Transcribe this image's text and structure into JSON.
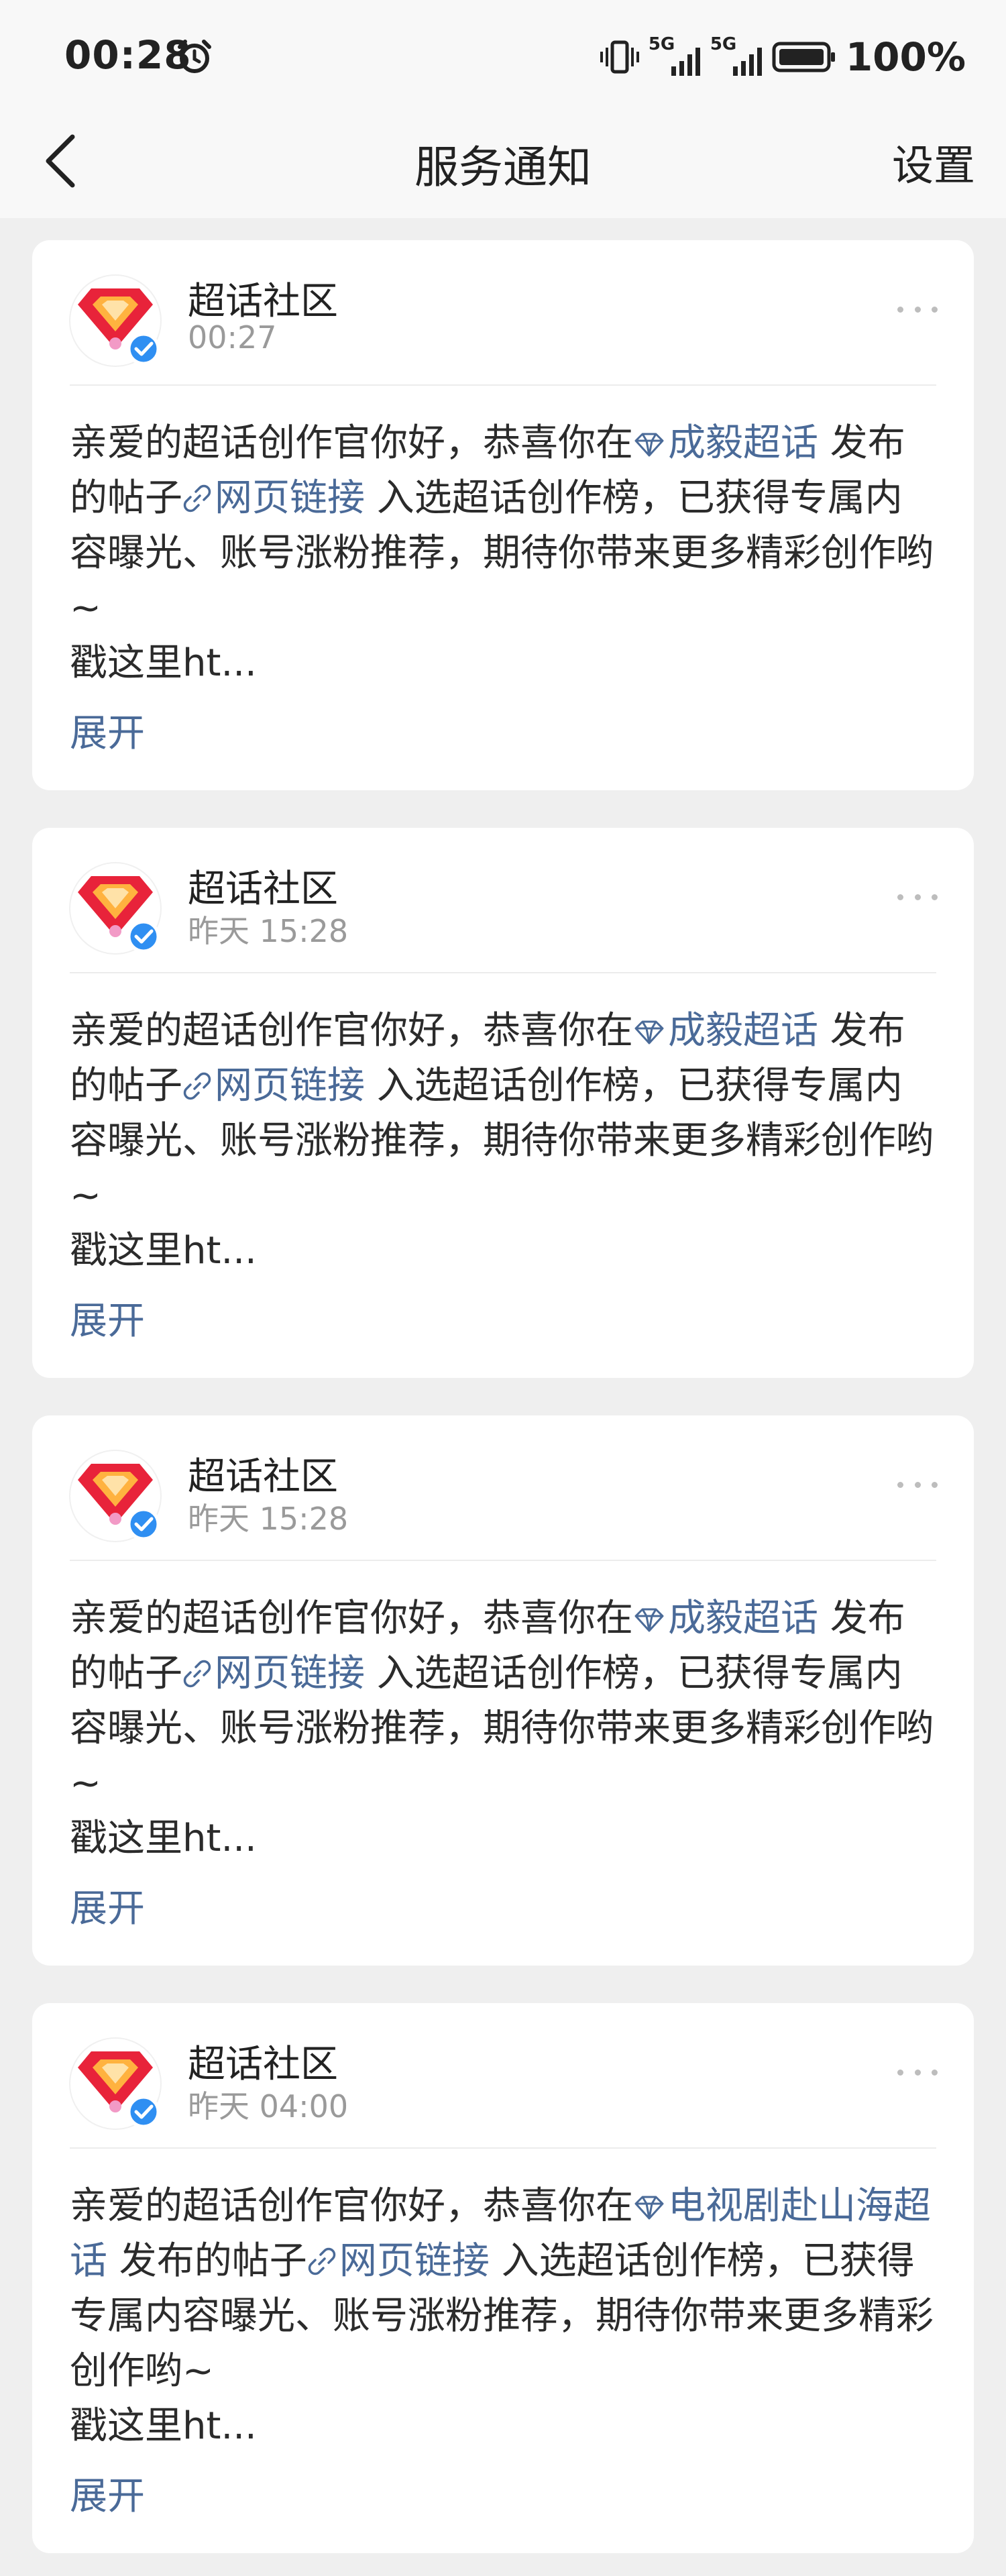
{
  "status_bar": {
    "time": "00:28",
    "network_1": "5G",
    "network_2": "5G",
    "battery": "100%"
  },
  "nav": {
    "title": "服务通知",
    "settings_label": "设置"
  },
  "icons": {
    "back": "chevron-left-icon",
    "more": "more-dots-icon",
    "topic": "diamond-icon",
    "link": "link-icon",
    "verified": "verified-badge-icon",
    "avatar": "super-topic-logo-icon"
  },
  "colors": {
    "link": "#4a6a98",
    "avatar_red": "#e8233a",
    "avatar_orange": "#ffb23f",
    "verified_blue": "#2f8ff2"
  },
  "notifications": [
    {
      "sender": "超话社区",
      "time": "00:27",
      "intro": "亲爱的超话创作官你好，恭喜你在",
      "topic": "成毅超话",
      "mid": " 发布的帖子",
      "link_label": "网页链接",
      "rest": " 入选超话创作榜，已获得专属内容曝光、账号涨粉推荐，期待你带来更多精彩创作哟~",
      "truncated": "戳这里ht...",
      "expand_label": "展开"
    },
    {
      "sender": "超话社区",
      "time": "昨天 15:28",
      "intro": "亲爱的超话创作官你好，恭喜你在",
      "topic": "成毅超话",
      "mid": " 发布的帖子",
      "link_label": "网页链接",
      "rest": " 入选超话创作榜，已获得专属内容曝光、账号涨粉推荐，期待你带来更多精彩创作哟~",
      "truncated": "戳这里ht...",
      "expand_label": "展开"
    },
    {
      "sender": "超话社区",
      "time": "昨天 15:28",
      "intro": "亲爱的超话创作官你好，恭喜你在",
      "topic": "成毅超话",
      "mid": " 发布的帖子",
      "link_label": "网页链接",
      "rest": " 入选超话创作榜，已获得专属内容曝光、账号涨粉推荐，期待你带来更多精彩创作哟~",
      "truncated": "戳这里ht...",
      "expand_label": "展开"
    },
    {
      "sender": "超话社区",
      "time": "昨天 04:00",
      "intro": "亲爱的超话创作官你好，恭喜你在",
      "topic": "电视剧赴山海超话",
      "mid": " 发布的帖子",
      "link_label": "网页链接",
      "rest": " 入选超话创作榜，已获得专属内容曝光、账号涨粉推荐，期待你带来更多精彩创作哟~",
      "truncated": "戳这里ht...",
      "expand_label": "展开"
    }
  ]
}
